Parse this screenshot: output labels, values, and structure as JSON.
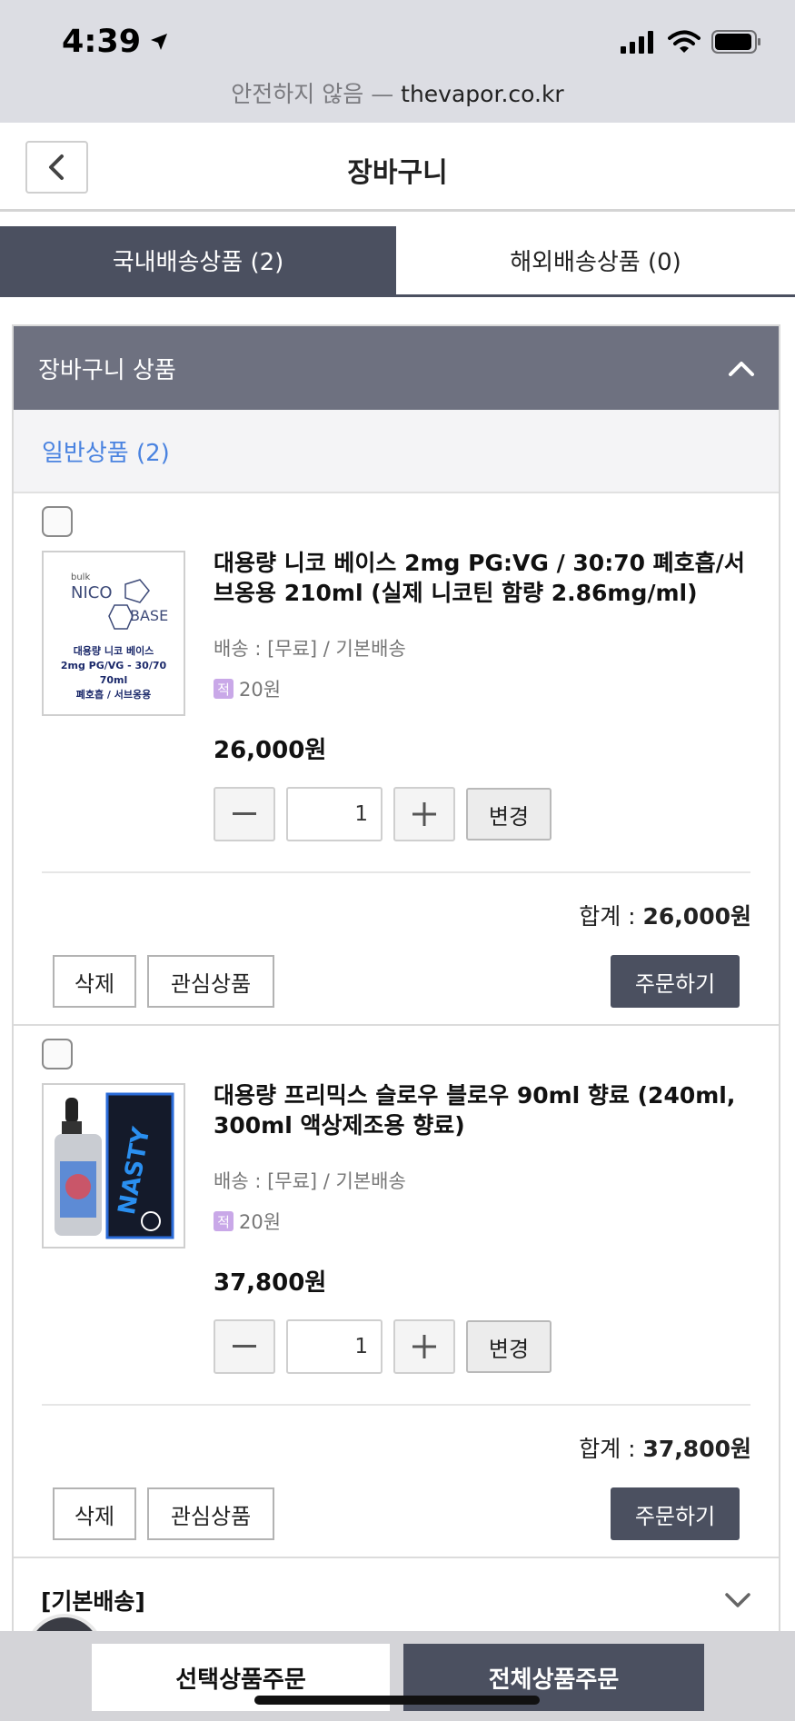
{
  "status_bar": {
    "time": "4:39"
  },
  "browser": {
    "security_label": "안전하지 않음 —",
    "host": "thevapor.co.kr"
  },
  "header": {
    "title": "장바구니"
  },
  "tabs": [
    {
      "label": "국내배송상품 (2)",
      "active": true
    },
    {
      "label": "해외배송상품 (0)",
      "active": false
    }
  ],
  "cart": {
    "section_title": "장바구니 상품",
    "group_label": "일반상품 (2)",
    "items": [
      {
        "name": "대용량 니코 베이스 2mg PG:VG / 30:70 폐호흡/서브옹용 210ml (실제 니코틴 함량 2.86mg/ml)",
        "shipping": "배송 : [무료] / 기본배송",
        "points_badge": "적",
        "points": "20원",
        "price": "26,000원",
        "quantity": "1",
        "change_label": "변경",
        "total_label": "합계 : ",
        "total_value": "26,000원",
        "delete_label": "삭제",
        "wishlist_label": "관심상품",
        "order_label": "주문하기",
        "thumb": {
          "brand": "bulk",
          "line1": "NICO",
          "line2": "BASE",
          "desc1": "대용량 니코 베이스",
          "desc2": "2mg PG/VG - 30/70",
          "desc3": "70ml",
          "desc4": "폐호흡 / 서브옹용"
        }
      },
      {
        "name": "대용량 프리믹스 슬로우 블로우 90ml 향료 (240ml, 300ml 액상제조용 향료)",
        "shipping": "배송 : [무료] / 기본배송",
        "points_badge": "적",
        "points": "20원",
        "price": "37,800원",
        "quantity": "1",
        "change_label": "변경",
        "total_label": "합계 : ",
        "total_value": "37,800원",
        "delete_label": "삭제",
        "wishlist_label": "관심상품",
        "order_label": "주문하기",
        "thumb": {
          "brand": "NASTY"
        }
      }
    ],
    "shipping_group": "[기본배송]"
  },
  "bottom_bar": {
    "order_selected": "선택상품주문",
    "order_all": "전체상품주문"
  },
  "colors": {
    "primary_dark": "#4b5060",
    "section_gray": "#6e7180",
    "link_blue": "#4a83e0",
    "points_purple": "#c9a8e8"
  }
}
